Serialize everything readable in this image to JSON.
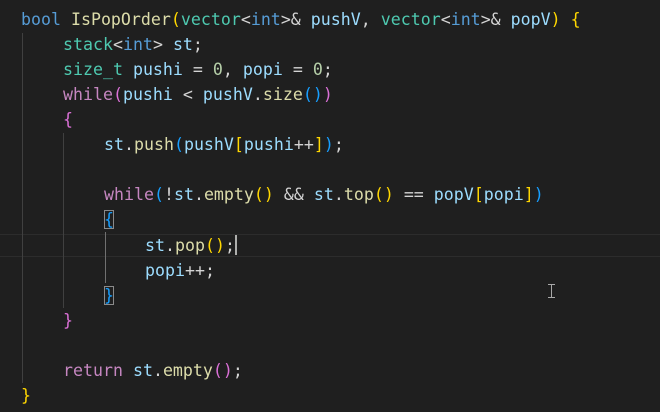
{
  "code": {
    "l1": {
      "t1": "bool",
      "t2": "IsPopOrder",
      "t3": "(",
      "t4": "vector",
      "t5": "<",
      "t6": "int",
      "t7": ">&",
      "t8": "pushV",
      "t9": ",",
      "t10": "vector",
      "t11": "<",
      "t12": "int",
      "t13": ">&",
      "t14": "popV",
      "t15": ")",
      "t16": "{"
    },
    "l2": {
      "t1": "stack",
      "t2": "<",
      "t3": "int",
      "t4": ">",
      "t5": "st",
      "t6": ";"
    },
    "l3": {
      "t1": "size_t",
      "t2": "pushi",
      "t3": "=",
      "t4": "0",
      "t5": ",",
      "t6": "popi",
      "t7": "=",
      "t8": "0",
      "t9": ";"
    },
    "l4": {
      "t1": "while",
      "t2": "(",
      "t3": "pushi",
      "t4": "<",
      "t5": "pushV",
      "t6": ".",
      "t7": "size",
      "t8": "()",
      "t9": ")"
    },
    "l5": {
      "t1": "{"
    },
    "l6": {
      "t1": "st",
      "t2": ".",
      "t3": "push",
      "t4": "(",
      "t5": "pushV",
      "t6": "[",
      "t7": "pushi",
      "t8": "++",
      "t9": "]",
      "t10": ")",
      "t11": ";"
    },
    "l8": {
      "t1": "while",
      "t2": "(",
      "t3": "!",
      "t4": "st",
      "t5": ".",
      "t6": "empty",
      "t7": "()",
      "t8": "&&",
      "t9": "st",
      "t10": ".",
      "t11": "top",
      "t12": "()",
      "t13": "==",
      "t14": "popV",
      "t15": "[",
      "t16": "popi",
      "t17": "]",
      "t18": ")"
    },
    "l9": {
      "t1": "{"
    },
    "l10": {
      "t1": "st",
      "t2": ".",
      "t3": "pop",
      "t4": "()",
      "t5": ";"
    },
    "l11": {
      "t1": "popi",
      "t2": "++",
      "t3": ";"
    },
    "l12": {
      "t1": "}"
    },
    "l13": {
      "t1": "}"
    },
    "l15": {
      "t1": "return",
      "t2": "st",
      "t3": ".",
      "t4": "empty",
      "t5": "()",
      "t6": ";"
    },
    "l16": {
      "t1": "}"
    }
  },
  "colors": {
    "background": "#1f1f1f",
    "keyword": "#569cd6",
    "control": "#c586c0",
    "type": "#4ec9b0",
    "function": "#dcdcaa",
    "variable": "#9cdcfe",
    "number": "#b5cea8",
    "bracket_level1": "#ffd700",
    "bracket_level2": "#da70d6",
    "bracket_level3": "#179fff"
  }
}
